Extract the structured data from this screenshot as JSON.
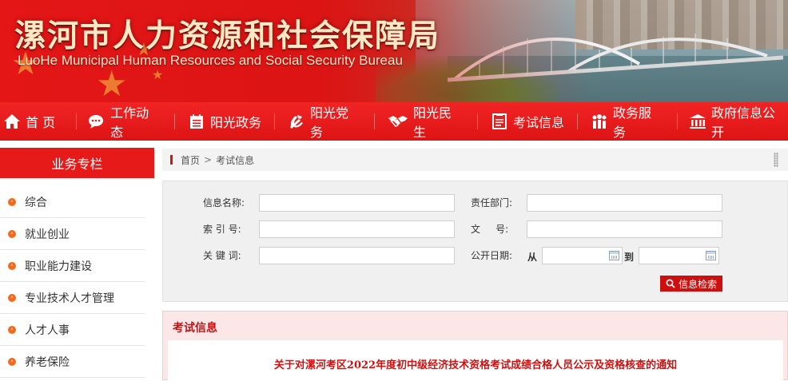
{
  "header": {
    "title_cn": "漯河市人力资源和社会保障局",
    "title_en": "LuoHe Municipal Human Resources and Social Security Bureau"
  },
  "nav": {
    "items": [
      {
        "label": "首 页",
        "icon": "home-icon"
      },
      {
        "label": "工作动态",
        "icon": "chat-icon"
      },
      {
        "label": "阳光政务",
        "icon": "calendar-icon"
      },
      {
        "label": "阳光党务",
        "icon": "party-emblem-icon"
      },
      {
        "label": "阳光民生",
        "icon": "handshake-icon"
      },
      {
        "label": "考试信息",
        "icon": "document-icon"
      },
      {
        "label": "政务服务",
        "icon": "people-icon"
      },
      {
        "label": "政府信息公开",
        "icon": "government-building-icon"
      }
    ]
  },
  "sidebar": {
    "title": "业务专栏",
    "items": [
      {
        "label": "综合"
      },
      {
        "label": "就业创业"
      },
      {
        "label": "职业能力建设"
      },
      {
        "label": "专业技术人才管理"
      },
      {
        "label": "人才人事"
      },
      {
        "label": "养老保险"
      }
    ]
  },
  "breadcrumb": {
    "home": "首页",
    "separator": ">",
    "current": "考试信息"
  },
  "search": {
    "info_name_label": "信息名称:",
    "dept_label": "责任部门:",
    "index_label": "索 引 号:",
    "doc_no_label": "文     号:",
    "keyword_label": "关 键 词:",
    "date_label": "公开日期:",
    "from": "从",
    "to": "到",
    "button": "信息检索"
  },
  "results": {
    "title": "考试信息",
    "items": [
      {
        "title": "关于对漯河考区2022年度初中级经济技术资格考试成绩合格人员公示及资格核查的通知"
      }
    ]
  },
  "colors": {
    "primary_red": "#e11a1a",
    "nav_red": "#e81b1b",
    "link_red": "#d01010",
    "bullet_orange": "#f26a1b"
  }
}
